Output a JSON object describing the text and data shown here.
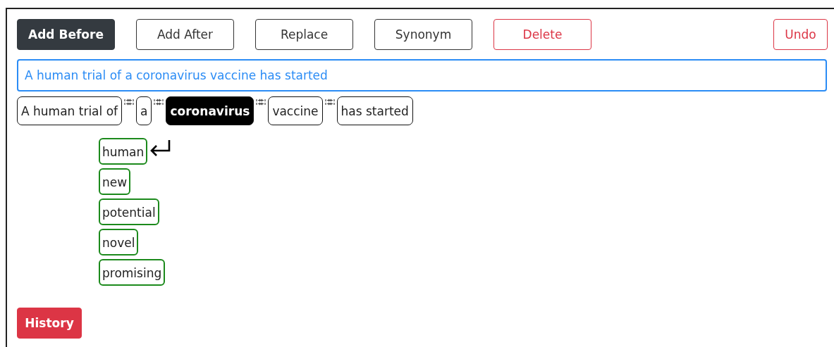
{
  "toolbar": {
    "modes": [
      {
        "label": "Add Before",
        "selected": true
      },
      {
        "label": "Add After",
        "selected": false
      },
      {
        "label": "Replace",
        "selected": false
      },
      {
        "label": "Synonym",
        "selected": false
      }
    ],
    "delete": "Delete",
    "undo": "Undo"
  },
  "sentence_field": {
    "value": "A human trial of a coronavirus vaccine has started"
  },
  "tokens": [
    {
      "text": "A human trial of",
      "selected": false
    },
    {
      "text": "a",
      "selected": false
    },
    {
      "text": "coronavirus",
      "selected": true
    },
    {
      "text": "vaccine",
      "selected": false
    },
    {
      "text": "has started",
      "selected": false
    }
  ],
  "suggestions": [
    {
      "text": "human",
      "marked": true
    },
    {
      "text": "new",
      "marked": false
    },
    {
      "text": "potential",
      "marked": false
    },
    {
      "text": "novel",
      "marked": false
    },
    {
      "text": "promising",
      "marked": false
    }
  ],
  "history_button": "History"
}
